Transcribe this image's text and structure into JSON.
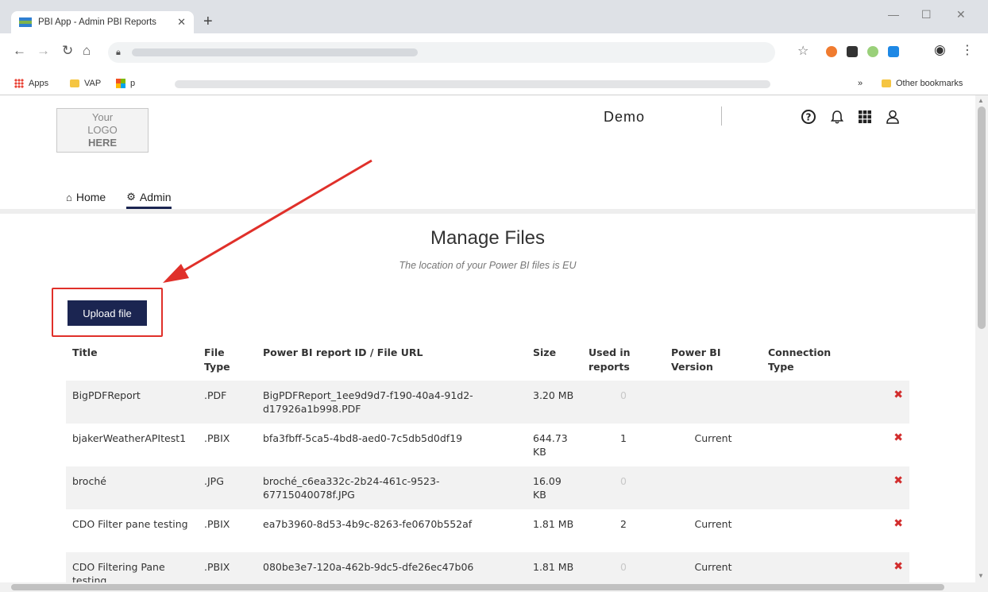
{
  "browser": {
    "tab_title": "PBI App - Admin PBI Reports",
    "new_tab": "+",
    "bookmarks": [
      {
        "label": "Apps"
      },
      {
        "label": "VAP"
      },
      {
        "label": "p"
      }
    ],
    "overflow": "»",
    "other_bookmarks": "Other bookmarks"
  },
  "header": {
    "logo_line1": "Your",
    "logo_line2": "LOGO",
    "logo_line3": "HERE",
    "brand": "Demo"
  },
  "nav": {
    "items": [
      {
        "label": "Home",
        "active": false
      },
      {
        "label": "Admin",
        "active": true
      }
    ]
  },
  "main": {
    "title": "Manage Files",
    "subtitle": "The location of your Power BI files is EU",
    "upload_label": "Upload file"
  },
  "table": {
    "headers": {
      "title": "Title",
      "file_type": "File Type",
      "id_url": "Power BI report ID / File URL",
      "size": "Size",
      "used": "Used in reports",
      "version": "Power BI Version",
      "connection": "Connection Type"
    },
    "rows": [
      {
        "title": "BigPDFReport",
        "type": ".PDF",
        "id": "BigPDFReport_1ee9d9d7-f190-40a4-91d2-d17926a1b998.PDF",
        "size": "3.20 MB",
        "used": "0",
        "version": "",
        "connection": ""
      },
      {
        "title": "bjakerWeatherAPItest1",
        "type": ".PBIX",
        "id": "bfa3fbff-5ca5-4bd8-aed0-7c5db5d0df19",
        "size": "644.73 KB",
        "used": "1",
        "version": "Current",
        "connection": ""
      },
      {
        "title": "broché",
        "type": ".JPG",
        "id": "broché_c6ea332c-2b24-461c-9523-67715040078f.JPG",
        "size": "16.09 KB",
        "used": "0",
        "version": "",
        "connection": ""
      },
      {
        "title": "CDO Filter pane testing",
        "type": ".PBIX",
        "id": "ea7b3960-8d53-4b9c-8263-fe0670b552af",
        "size": "1.81 MB",
        "used": "2",
        "version": "Current",
        "connection": ""
      },
      {
        "title": "CDO Filtering Pane testing",
        "type": ".PBIX",
        "id": "080be3e7-120a-462b-9dc5-dfe26ec47b06",
        "size": "1.81 MB",
        "used": "0",
        "version": "Current",
        "connection": ""
      }
    ],
    "delete_glyph": "✖"
  },
  "colors": {
    "accent": "#1b2551",
    "callout": "#e0302a",
    "delete": "#d22d2d"
  }
}
